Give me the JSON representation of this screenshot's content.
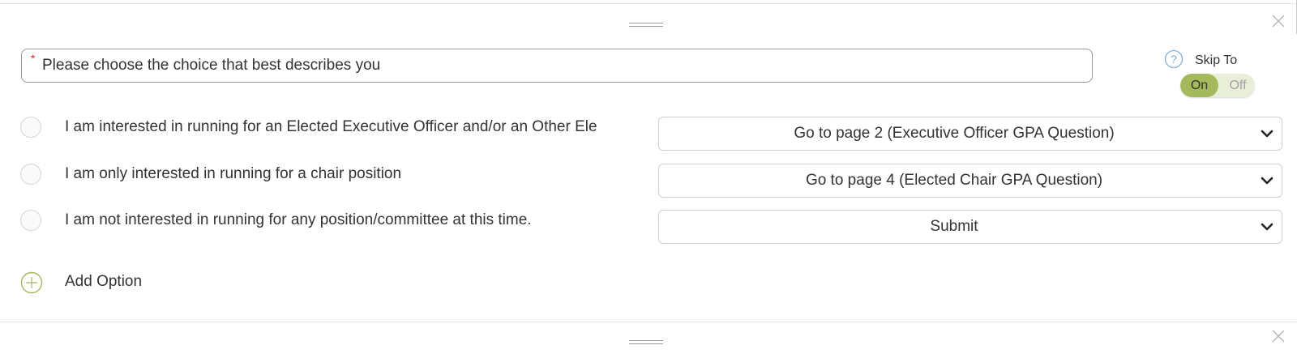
{
  "question": {
    "required_marker": "*",
    "text": "Please choose the choice that best describes you"
  },
  "skip_to": {
    "label": "Skip To",
    "help_icon": "question-circle-icon",
    "toggle_on": "On",
    "toggle_off": "Off",
    "state": "on"
  },
  "options": [
    {
      "label": "I am interested in running for an Elected Executive Officer and/or an Other Ele",
      "skip_target": "Go to page 2 (Executive Officer GPA Question)"
    },
    {
      "label": "I am only interested in running for a chair position",
      "skip_target": "Go to page 4 (Elected Chair GPA Question)"
    },
    {
      "label": "I am not interested in running for any position/committee at this time.",
      "skip_target": "Submit"
    }
  ],
  "add_option": {
    "label": "Add Option",
    "icon": "plus-circle-icon"
  },
  "colors": {
    "accent": "#a4b95c",
    "toggle_track": "#e9eed8",
    "required": "#d9262c",
    "help_icon": "#7fb0cf"
  }
}
